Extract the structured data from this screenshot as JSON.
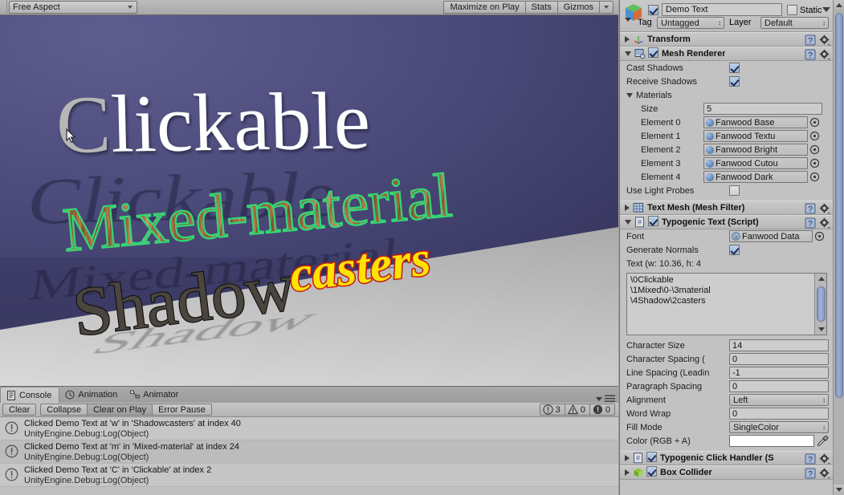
{
  "game_view": {
    "toolbar": {
      "aspect_label": "Free Aspect",
      "maximize_label": "Maximize on Play",
      "stats_label": "Stats",
      "gizmos_label": "Gizmos"
    },
    "scene_text": {
      "line1_selected": "C",
      "line1_rest": "lickable",
      "line1_shadow": "Clickable",
      "line2_a": "Mixed",
      "line2_b": "-material",
      "line2_shadow": "Mixed-material",
      "line3_a": "Shadow",
      "line3_b": "casters",
      "line3_cast_shadow": "Shadow"
    },
    "colors": {
      "wall": "#4d4c7c",
      "floor": "#a6a6a6",
      "clickable_white": "#ffffff",
      "clickable_selected_gray": "#b6b6b6",
      "mixed_outline_green": "#2fd977",
      "mixed_wood": "#c98b58",
      "shadow_fill": "#4a453f",
      "shadow_outline": "#14120f",
      "casters_fill": "#ffe300",
      "casters_outline": "#c41a1a"
    }
  },
  "console": {
    "tabs": [
      {
        "label": "Console",
        "icon": "console-icon",
        "active": true
      },
      {
        "label": "Animation",
        "icon": "clock-icon",
        "active": false
      },
      {
        "label": "Animator",
        "icon": "animator-icon",
        "active": false
      }
    ],
    "buttons": [
      {
        "label": "Clear",
        "toggled": false
      },
      {
        "label": "Collapse",
        "toggled": false
      },
      {
        "label": "Clear on Play",
        "toggled": true
      },
      {
        "label": "Error Pause",
        "toggled": false
      }
    ],
    "counters": [
      {
        "icon": "info-icon",
        "count": "3"
      },
      {
        "icon": "warning-icon",
        "count": "0"
      },
      {
        "icon": "error-icon",
        "count": "0"
      }
    ],
    "entries": [
      {
        "icon": "info-icon",
        "message": "Clicked Demo Text at 'w' in 'Shadowcasters' at index 40",
        "stack": "UnityEngine.Debug:Log(Object)"
      },
      {
        "icon": "info-icon",
        "message": "Clicked Demo Text at 'm' in 'Mixed-material' at index 24",
        "stack": "UnityEngine.Debug:Log(Object)"
      },
      {
        "icon": "info-icon",
        "message": "Clicked Demo Text at 'C' in 'Clickable' at index 2",
        "stack": "UnityEngine.Debug:Log(Object)"
      }
    ]
  },
  "inspector": {
    "gameobject": {
      "active": true,
      "name": "Demo Text",
      "static_label": "Static",
      "static_checked": false,
      "tag_label": "Tag",
      "tag_value": "Untagged",
      "layer_label": "Layer",
      "layer_value": "Default"
    },
    "components": [
      {
        "title": "Transform",
        "icon": "transform-icon",
        "expanded": false,
        "has_enable_checkbox": false
      },
      {
        "title": "Mesh Renderer",
        "icon": "mesh-renderer-icon",
        "expanded": true,
        "has_enable_checkbox": true,
        "enabled": true
      },
      {
        "title": "Text Mesh (Mesh Filter)",
        "icon": "mesh-filter-icon",
        "expanded": false,
        "has_enable_checkbox": false
      },
      {
        "title": "Typogenic Text (Script)",
        "icon": "script-icon",
        "expanded": true,
        "has_enable_checkbox": true,
        "enabled": true
      },
      {
        "title": "Typogenic Click Handler (S",
        "icon": "script-icon",
        "expanded": false,
        "has_enable_checkbox": true,
        "enabled": true
      },
      {
        "title": "Box Collider",
        "icon": "box-collider-icon",
        "expanded": false,
        "has_enable_checkbox": true,
        "enabled": true
      }
    ],
    "mesh_renderer": {
      "cast_shadows_label": "Cast Shadows",
      "cast_shadows": true,
      "receive_shadows_label": "Receive Shadows",
      "receive_shadows": true,
      "materials_label": "Materials",
      "size_label": "Size",
      "size_value": "5",
      "elements": [
        {
          "label": "Element 0",
          "value": "Fanwood Base"
        },
        {
          "label": "Element 1",
          "value": "Fanwood Textu"
        },
        {
          "label": "Element 2",
          "value": "Fanwood Bright"
        },
        {
          "label": "Element 3",
          "value": "Fanwood Cutou"
        },
        {
          "label": "Element 4",
          "value": "Fanwood Dark"
        }
      ],
      "use_light_probes_label": "Use Light Probes",
      "use_light_probes": false
    },
    "typogenic_text": {
      "font_label": "Font",
      "font_value": "Fanwood Data",
      "generate_normals_label": "Generate Normals",
      "generate_normals": true,
      "text_label": "Text (w: 10.36, h: 4",
      "text_value": "\\0Clickable\n\\1Mixed\\0-\\3material\n\\4Shadow\\2casters",
      "character_size_label": "Character Size",
      "character_size_value": "14",
      "character_spacing_label": "Character Spacing (",
      "character_spacing_value": "0",
      "line_spacing_label": "Line Spacing (Leadin",
      "line_spacing_value": "-1",
      "paragraph_spacing_label": "Paragraph Spacing",
      "paragraph_spacing_value": "0",
      "alignment_label": "Alignment",
      "alignment_value": "Left",
      "word_wrap_label": "Word Wrap",
      "word_wrap_value": "0",
      "fill_mode_label": "Fill Mode",
      "fill_mode_value": "SingleColor",
      "color_label": "Color (RGB + A)",
      "color_value": "#ffffff"
    }
  }
}
